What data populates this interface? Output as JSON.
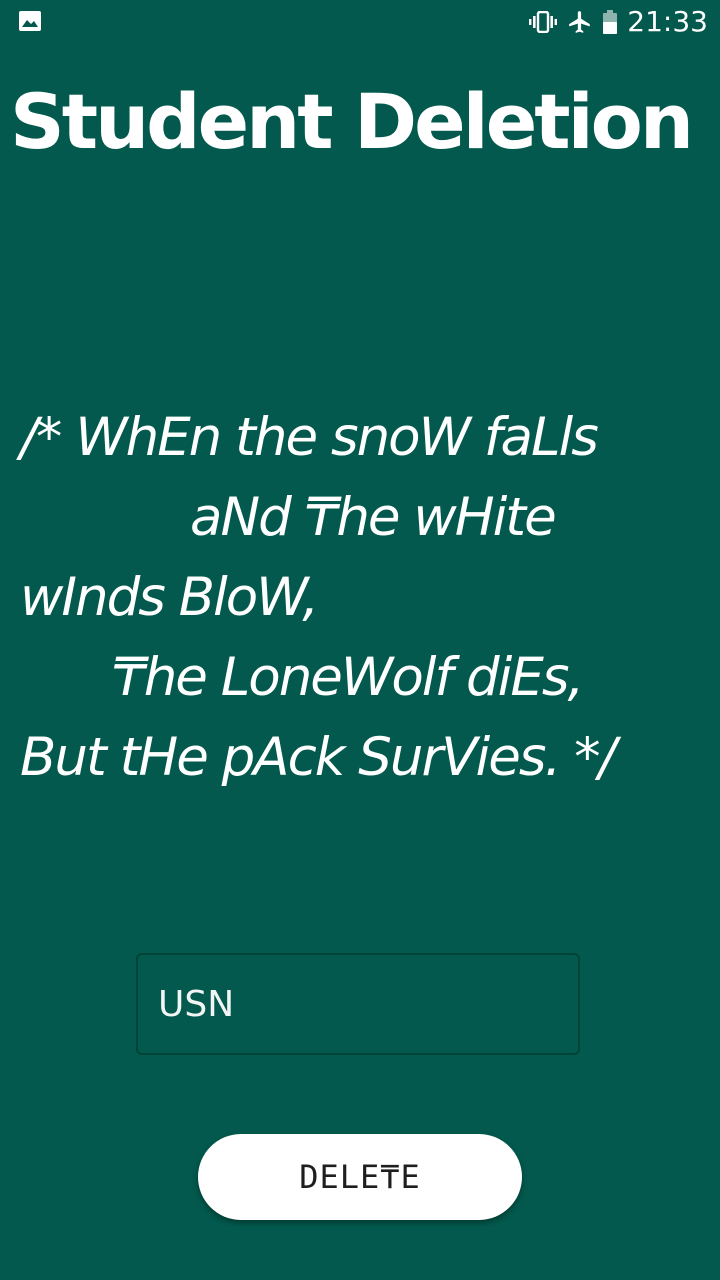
{
  "status_bar": {
    "time": "21:33",
    "icons": [
      "gallery-icon",
      "vibrate-icon",
      "airplane-mode-icon",
      "battery-icon"
    ]
  },
  "title": "Student Deletion",
  "quote_lines": [
    "/*  WhEn the snoW faLls",
    "aNd ₸he wHite",
    "wInds BloW,",
    "₸he LoneWolf diEs,",
    "But tHe pAck SurVies. */"
  ],
  "usn_field": {
    "value": "",
    "placeholder": "USN"
  },
  "delete_button": {
    "label": "DELE₸E"
  },
  "colors": {
    "background": "#03594d",
    "field_border": "#014337",
    "button_bg": "#ffffff",
    "button_text": "#1e1e1e"
  }
}
